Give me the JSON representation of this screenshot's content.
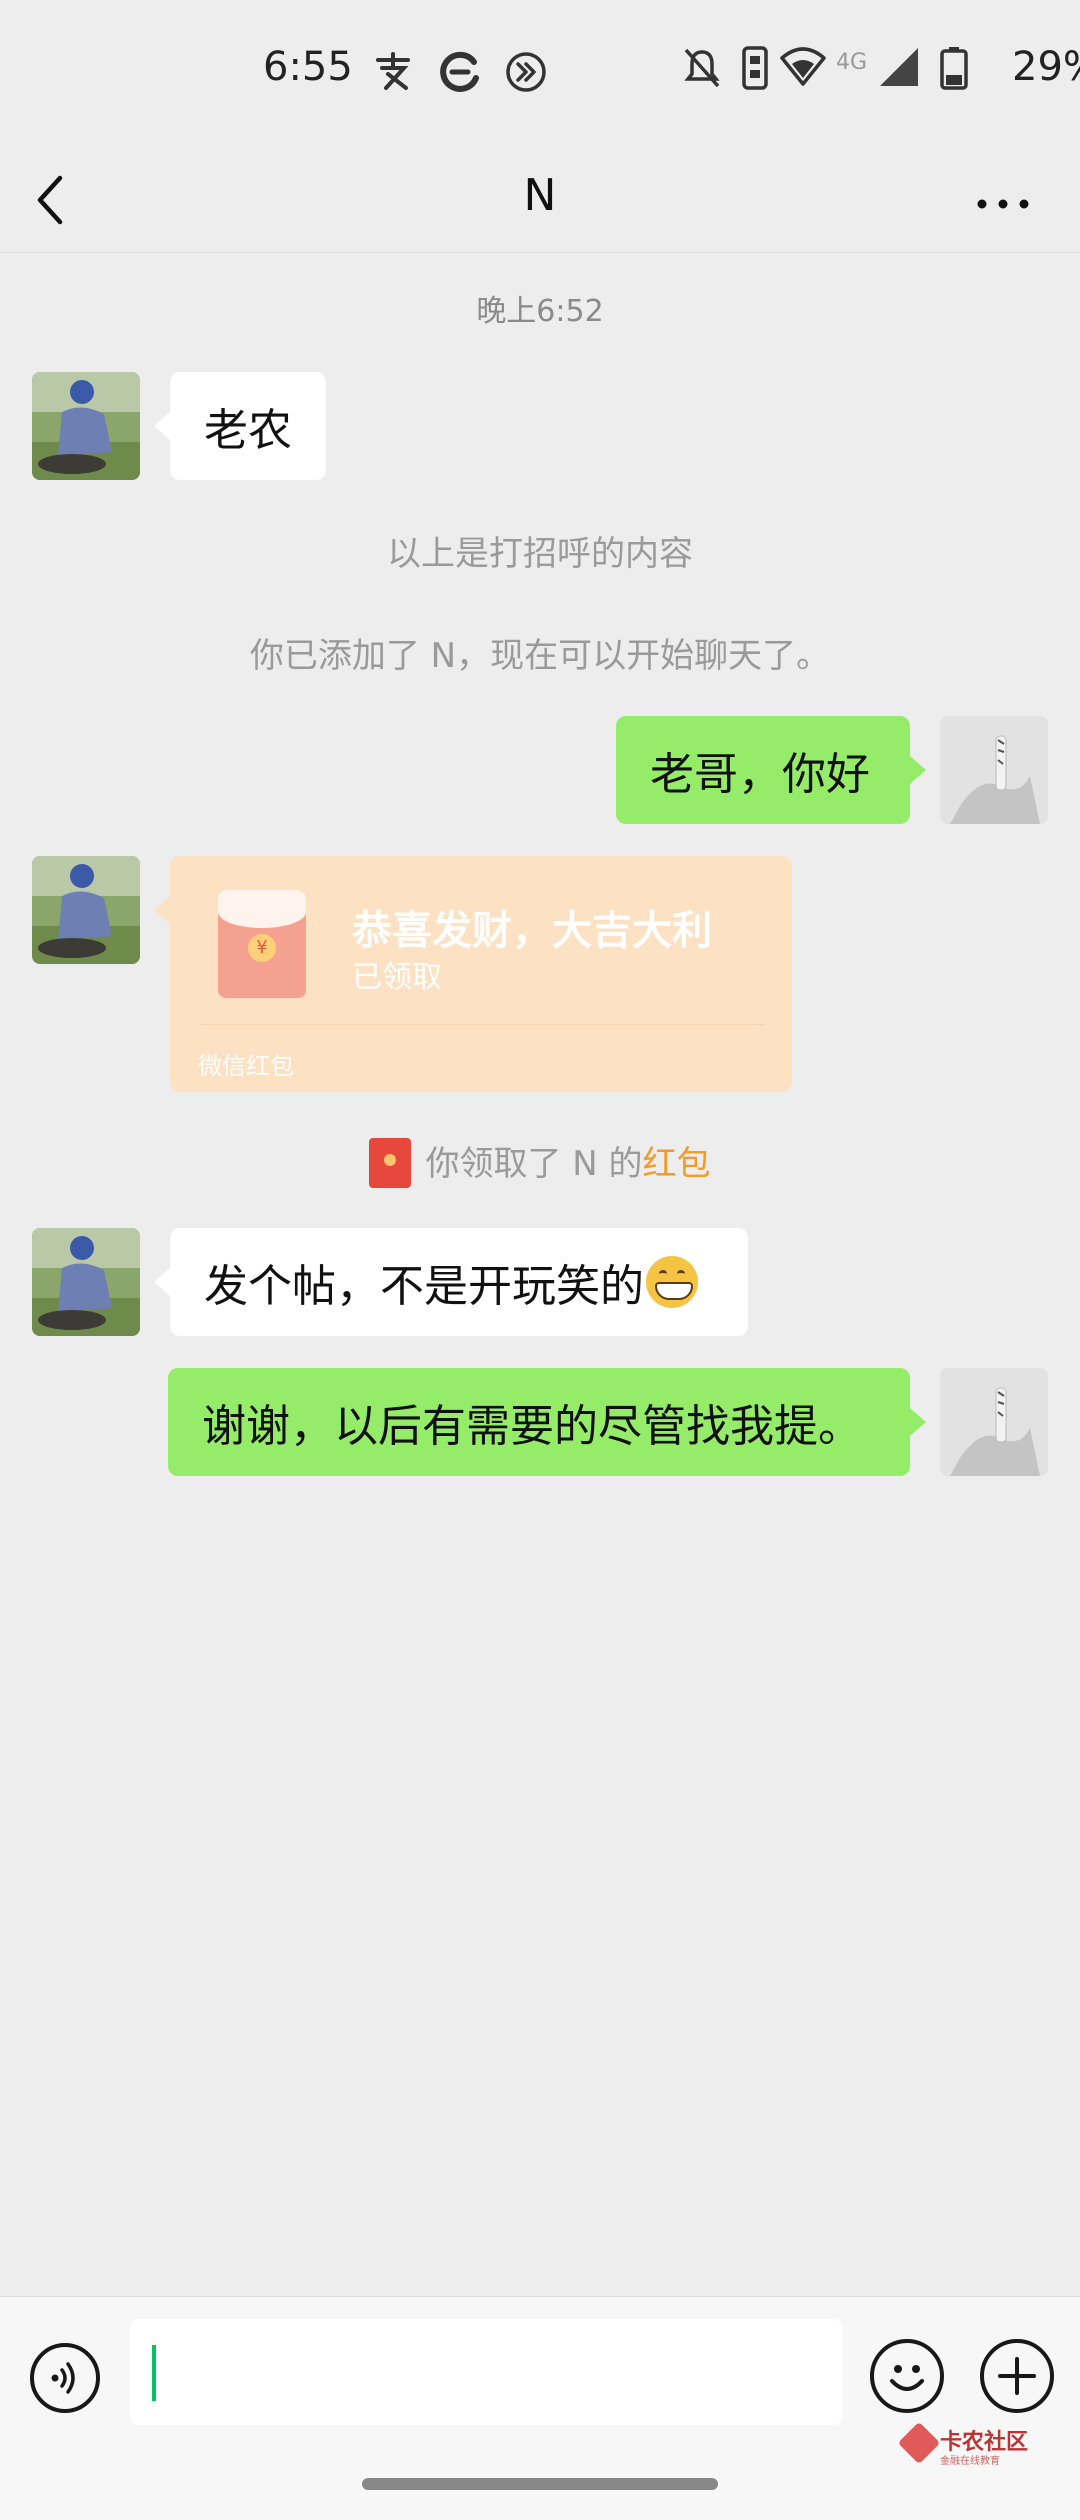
{
  "status_bar": {
    "time": "6:55",
    "app_icons": [
      "alipay-icon",
      "browser-icon",
      "forward-icon"
    ],
    "network": "4G",
    "battery": "29%"
  },
  "header": {
    "title": "N",
    "back_icon": "chevron-left-icon",
    "more_icon": "more-dots-icon"
  },
  "chat": {
    "timestamp": "晚上6:52",
    "messages": [
      {
        "side": "left",
        "type": "text",
        "text": "老农"
      },
      {
        "type": "system",
        "text": "以上是打招呼的内容"
      },
      {
        "type": "system",
        "text": "你已添加了 N，现在可以开始聊天了。"
      },
      {
        "side": "right",
        "type": "text",
        "text": "老哥，你好"
      },
      {
        "side": "left",
        "type": "red_packet",
        "title": "恭喜发财，大吉大利",
        "status": "已领取",
        "footer": "微信红包"
      },
      {
        "type": "system_red_packet",
        "prefix": "你领取了 N 的",
        "link": "红包"
      },
      {
        "side": "left",
        "type": "text",
        "text": "发个帖，不是开玩笑的",
        "emoji": "grinning-face-icon"
      },
      {
        "side": "right",
        "type": "text",
        "text": "谢谢，以后有需要的尽管找我提。"
      }
    ]
  },
  "input_bar": {
    "voice_icon": "voice-icon",
    "emoji_icon": "smiley-icon",
    "plus_icon": "plus-icon",
    "value": ""
  },
  "watermark": {
    "text": "卡农社区",
    "sub": "金融在线教育"
  },
  "colors": {
    "background": "#ededed",
    "sent_bubble": "#95ec69",
    "received_bubble": "#ffffff",
    "red_packet": "#fde1c3",
    "link": "#f39a29",
    "caret": "#07c160"
  }
}
